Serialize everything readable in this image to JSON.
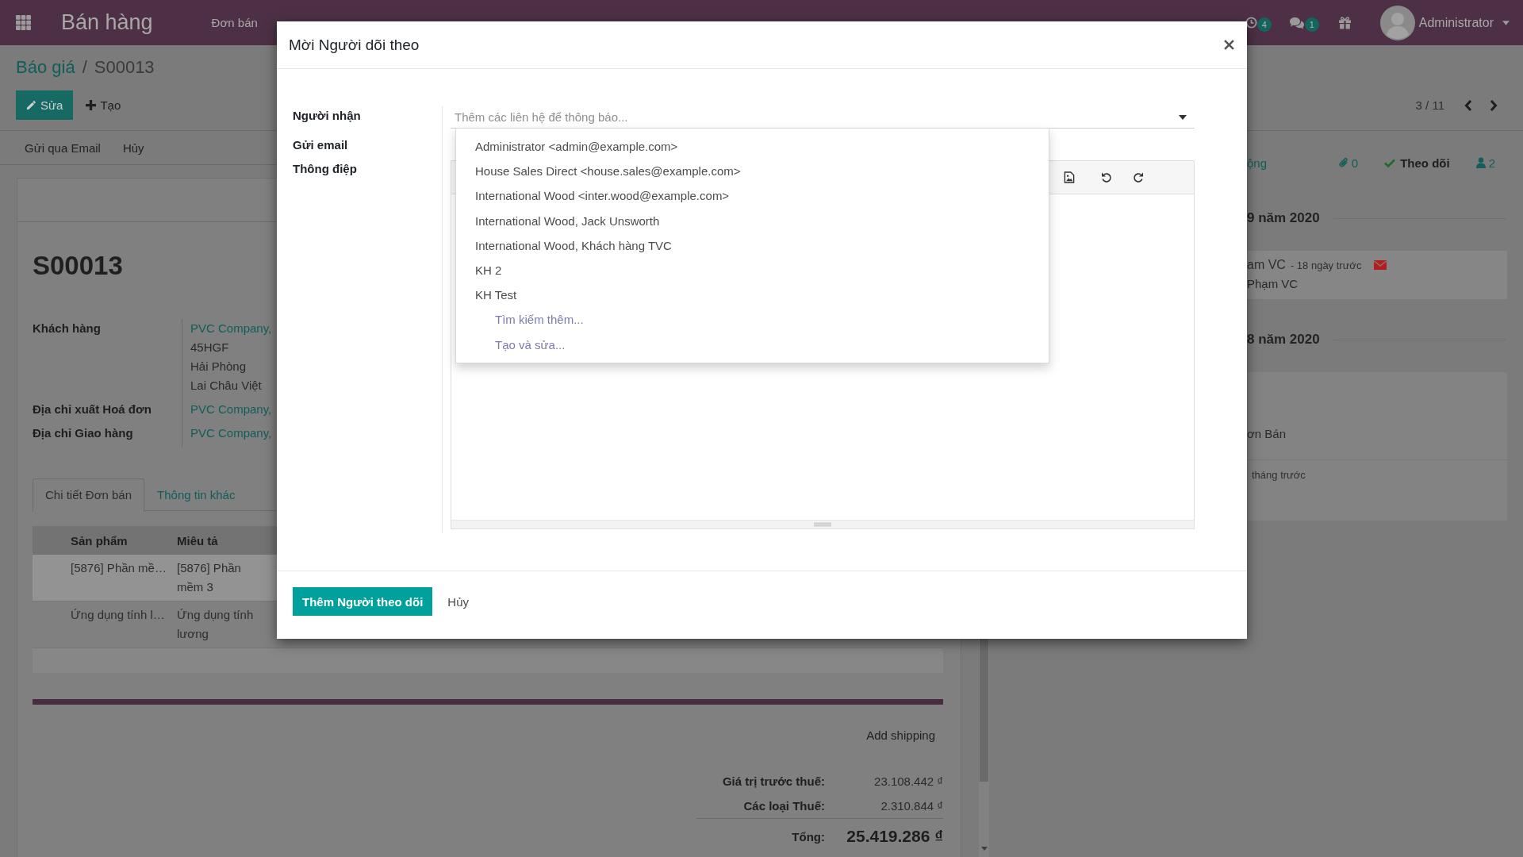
{
  "navbar": {
    "app_name": "Bán hàng",
    "menu": [
      "Đơn bán"
    ],
    "activity_badge": "4",
    "message_badge": "1",
    "user": "Administrator"
  },
  "control_panel": {
    "breadcrumb": [
      {
        "label": "Báo giá",
        "kind": "link"
      },
      {
        "label": "S00013",
        "kind": "current"
      }
    ],
    "breadcrumb_separator": "/",
    "buttons": [
      {
        "label": "Sửa",
        "kind": "edit"
      },
      {
        "label": "Tạo",
        "kind": "create"
      }
    ],
    "pager": "3 / 11"
  },
  "status_bar": {
    "buttons": [
      "Gửi qua Email",
      "Hủy"
    ]
  },
  "form": {
    "title": "S00013",
    "fields": [
      {
        "label": "Khách hàng",
        "lines": [
          {
            "text": "PVC Company,",
            "kind": "link"
          },
          {
            "text": "45HGF",
            "kind": "text"
          },
          {
            "text": "Hải Phòng",
            "kind": "text"
          },
          {
            "text": "Lai Châu Việt",
            "kind": "text"
          }
        ]
      },
      {
        "label": "Địa chỉ xuất Hoá đơn",
        "lines": [
          {
            "text": "PVC Company,",
            "kind": "link"
          }
        ]
      },
      {
        "label": "Địa chỉ Giao hàng",
        "lines": [
          {
            "text": "PVC Company,",
            "kind": "link"
          }
        ]
      }
    ],
    "tabs": [
      {
        "label": "Chi tiết Đơn bán",
        "selected": true
      },
      {
        "label": "Thông tin khác",
        "selected": false
      }
    ],
    "table": {
      "columns": [
        "Sản phẩm",
        "Miêu tả"
      ],
      "rows": [
        {
          "selected": true,
          "cells": [
            "[5876] Phần mề…",
            "[5876] Phần mềm 3"
          ]
        },
        {
          "selected": false,
          "cells": [
            "Ứng dụng tính l…",
            "Ứng dụng tính lương"
          ]
        }
      ]
    },
    "add_shipping": "Add shipping",
    "totals": [
      {
        "label": "Giá trị trước thuế:",
        "value": "23.108.442 ₫",
        "kind": "subtotal"
      },
      {
        "label": "Các loại Thuế:",
        "value": "2.310.844 ₫",
        "kind": "subtotal"
      },
      {
        "label": "Tổng:",
        "value": "25.419.286 ₫",
        "kind": "total"
      }
    ]
  },
  "chatter": {
    "tab_fragment": "ộng",
    "attachments": "0",
    "follow": {
      "label": "Theo dõi",
      "following": true
    },
    "followers": "2",
    "groups": [
      {
        "date": "9 năm 2020",
        "messages": [
          {
            "kind": "email",
            "author": "am VC",
            "time": "- 18 ngày trước",
            "body": "Phạm VC"
          }
        ]
      },
      {
        "date": "8 năm 2020",
        "messages": [
          {
            "kind": "note",
            "body": "ơn Bán"
          },
          {
            "kind": "note",
            "time": "tháng trước"
          }
        ]
      }
    ]
  },
  "dialog": {
    "title": "Mời Người dõi theo",
    "labels": [
      "Người nhận",
      "Gửi email",
      "Thông điệp"
    ],
    "recipients": {
      "placeholder": "Thêm các liên hệ để thông báo..."
    },
    "suggestions": [
      {
        "label": "Administrator <admin@example.com>",
        "kind": "contact"
      },
      {
        "label": "House Sales Direct <house.sales@example.com>",
        "kind": "contact"
      },
      {
        "label": "International Wood <inter.wood@example.com>",
        "kind": "contact"
      },
      {
        "label": "International Wood, Jack Unsworth",
        "kind": "contact"
      },
      {
        "label": "International Wood, Khách hàng TVC",
        "kind": "contact"
      },
      {
        "label": "KH 2",
        "kind": "contact"
      },
      {
        "label": "KH Test",
        "kind": "contact"
      },
      {
        "label": "Tìm kiếm thêm...",
        "kind": "action"
      },
      {
        "label": "Tạo và sửa...",
        "kind": "action"
      }
    ],
    "buttons": [
      {
        "label": "Thêm Người theo dõi",
        "kind": "primary"
      },
      {
        "label": "Hủy",
        "kind": "link"
      }
    ]
  }
}
